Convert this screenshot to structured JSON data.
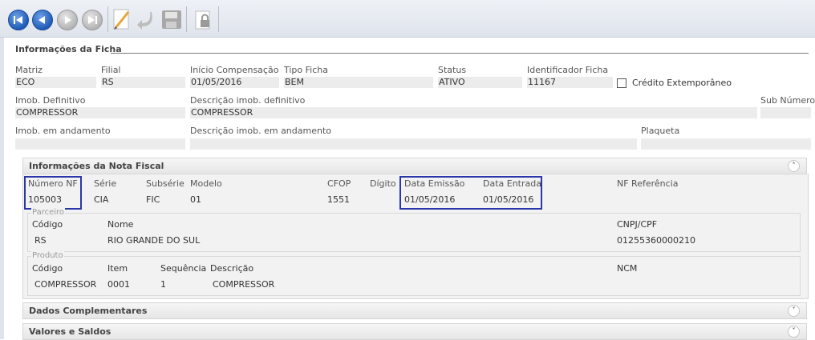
{
  "toolbar": {
    "icons": [
      "first-record-icon",
      "previous-record-icon",
      "next-record-icon",
      "last-record-icon",
      "edit-icon",
      "undo-icon",
      "save-icon",
      "lock-icon"
    ]
  },
  "ficha": {
    "title": "Informações da Ficha",
    "matriz": {
      "label": "Matriz",
      "value": "ECO"
    },
    "filial": {
      "label": "Filial",
      "value": "RS"
    },
    "inicio": {
      "label": "Início Compensação",
      "value": "01/05/2016"
    },
    "tipo": {
      "label": "Tipo Ficha",
      "value": "BEM"
    },
    "status": {
      "label": "Status",
      "value": "ATIVO"
    },
    "ident": {
      "label": "Identificador Ficha",
      "value": "11167"
    },
    "credito": {
      "label": "Crédito Extemporâneo",
      "checked": false
    },
    "imob_def": {
      "label": "Imob. Definitivo",
      "value": "COMPRESSOR"
    },
    "desc_def": {
      "label": "Descrição imob. definitivo",
      "value": "COMPRESSOR"
    },
    "sub_numero": {
      "label": "Sub Número",
      "value": ""
    },
    "imob_and": {
      "label": "Imob. em andamento",
      "value": ""
    },
    "desc_and": {
      "label": "Descrição imob. em andamento",
      "value": ""
    },
    "plaqueta": {
      "label": "Plaqueta",
      "value": ""
    }
  },
  "nota": {
    "title": "Informações da Nota Fiscal",
    "numero": {
      "label": "Número NF",
      "value": "105003"
    },
    "serie": {
      "label": "Série",
      "value": "CIA"
    },
    "subserie": {
      "label": "Subsérie",
      "value": "FIC"
    },
    "modelo": {
      "label": "Modelo",
      "value": "01"
    },
    "cfop": {
      "label": "CFOP",
      "value": "1551"
    },
    "digito": {
      "label": "Dígito",
      "value": ""
    },
    "emissao": {
      "label": "Data Emissão",
      "value": "01/05/2016"
    },
    "entrada": {
      "label": "Data Entrada",
      "value": "01/05/2016"
    },
    "nf_ref": {
      "label": "NF Referência",
      "value": ""
    },
    "parceiro": {
      "legend": "Parceiro",
      "codigo": {
        "label": "Código",
        "value": "RS"
      },
      "nome": {
        "label": "Nome",
        "value": "RIO GRANDE DO SUL"
      },
      "cnpj": {
        "label": "CNPJ/CPF",
        "value": "01255360000210"
      }
    },
    "produto": {
      "legend": "Produto",
      "codigo": {
        "label": "Código",
        "value": "COMPRESSOR"
      },
      "item": {
        "label": "Item",
        "value": "0001"
      },
      "sequencia": {
        "label": "Sequência",
        "value": "1"
      },
      "descricao": {
        "label": "Descrição",
        "value": "COMPRESSOR"
      },
      "ncm": {
        "label": "NCM",
        "value": ""
      }
    }
  },
  "panels": {
    "dados": "Dados Complementares",
    "valores": "Valores e Saldos"
  },
  "colors": {
    "highlight": "#2b36a8",
    "nav_blue": "#1f5cb8"
  }
}
